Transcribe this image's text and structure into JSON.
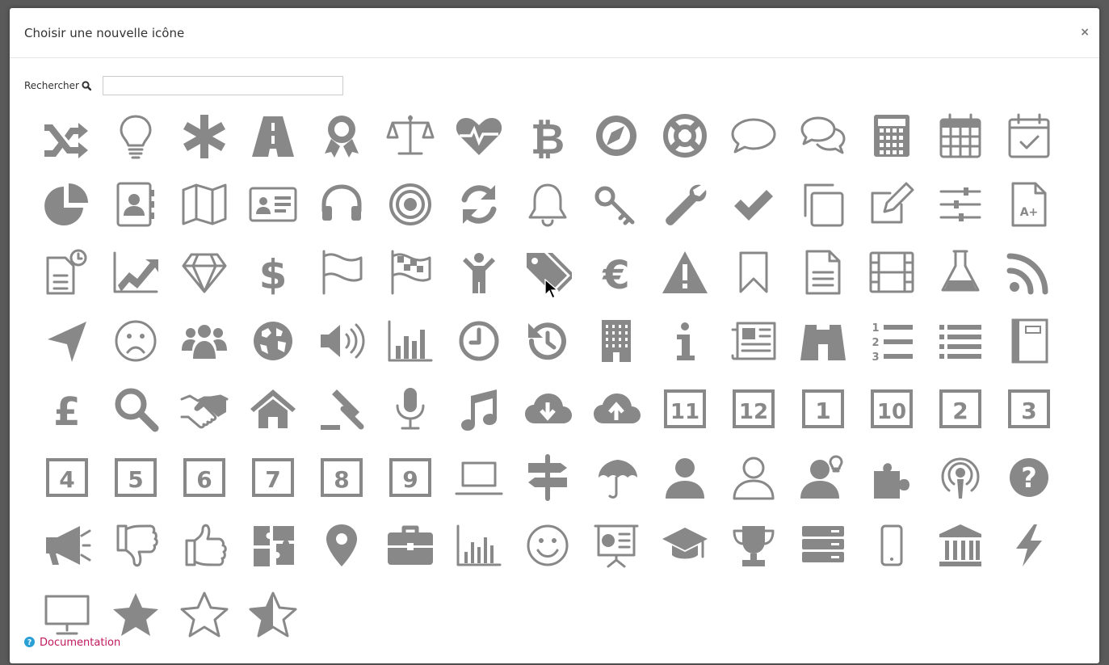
{
  "modal": {
    "title": "Choisir une nouvelle icône",
    "close_label": "×"
  },
  "search": {
    "label": "Rechercher",
    "value": "",
    "placeholder": ""
  },
  "icons": [
    "shuffle-icon",
    "lightbulb-icon",
    "asterisk-icon",
    "road-icon",
    "award-icon",
    "balance-scale-icon",
    "heartbeat-icon",
    "bitcoin-icon",
    "compass-icon",
    "life-ring-icon",
    "speech-bubble-icon",
    "comments-icon",
    "calculator-icon",
    "calendar-icon",
    "calendar-check-icon",
    "pie-chart-icon",
    "address-book-icon",
    "map-icon",
    "id-card-icon",
    "headphones-icon",
    "target-icon",
    "refresh-icon",
    "bell-icon",
    "key-icon",
    "wrench-icon",
    "check-icon",
    "copy-icon",
    "edit-icon",
    "sliders-icon",
    "grade-document-icon",
    "recent-document-icon",
    "line-chart-icon",
    "diamond-icon",
    "dollar-icon",
    "flag-outline-icon",
    "flag-checkered-icon",
    "child-icon",
    "tags-icon",
    "euro-icon",
    "warning-icon",
    "bookmark-icon",
    "document-icon",
    "film-icon",
    "flask-icon",
    "rss-icon",
    "location-arrow-icon",
    "frown-icon",
    "users-icon",
    "globe-icon",
    "volume-icon",
    "bar-chart-icon",
    "clock-icon",
    "history-icon",
    "building-icon",
    "info-icon",
    "newspaper-icon",
    "binoculars-icon",
    "ordered-list-icon",
    "list-icon",
    "notebook-icon",
    "pound-icon",
    "search-icon",
    "handshake-icon",
    "home-icon",
    "gavel-icon",
    "microphone-icon",
    "music-icon",
    "cloud-download-icon",
    "cloud-upload-icon",
    "number-11-icon",
    "number-12-icon",
    "number-1-icon",
    "number-10-icon",
    "number-2-icon",
    "number-3-icon",
    "number-4-icon",
    "number-5-icon",
    "number-6-icon",
    "number-7-icon",
    "number-8-icon",
    "number-9-icon",
    "laptop-icon",
    "signpost-icon",
    "umbrella-icon",
    "user-icon",
    "user-outline-icon",
    "user-idea-icon",
    "puzzle-piece-icon",
    "podcast-icon",
    "question-circle-icon",
    "bullhorn-icon",
    "thumbs-down-icon",
    "thumbs-up-icon",
    "puzzle-icon",
    "map-marker-icon",
    "briefcase-icon",
    "bar-chart-outline-icon",
    "smile-icon",
    "presentation-icon",
    "graduation-cap-icon",
    "trophy-icon",
    "server-icon",
    "mobile-icon",
    "bank-icon",
    "bolt-icon",
    "desktop-icon",
    "star-icon",
    "star-outline-icon",
    "star-half-icon"
  ],
  "numbers": {
    "number-11-icon": "11",
    "number-12-icon": "12",
    "number-1-icon": "1",
    "number-10-icon": "10",
    "number-2-icon": "2",
    "number-3-icon": "3",
    "number-4-icon": "4",
    "number-5-icon": "5",
    "number-6-icon": "6",
    "number-7-icon": "7",
    "number-8-icon": "8",
    "number-9-icon": "9"
  },
  "footer": {
    "documentation_label": "Documentation"
  },
  "colors": {
    "icon": "#888888",
    "link": "#c0175d",
    "help_icon": "#2a9fd6"
  }
}
